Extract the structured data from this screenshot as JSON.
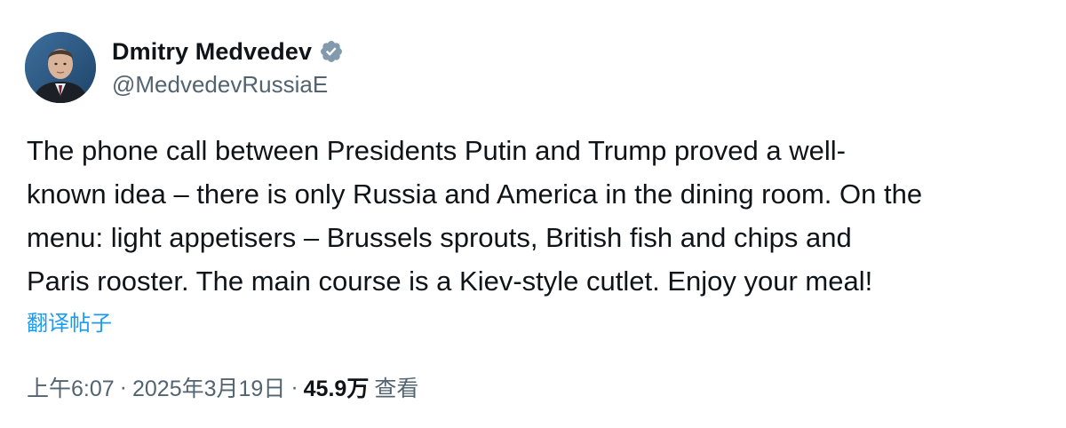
{
  "author": {
    "display_name": "Dmitry Medvedev",
    "handle": "@MedvedevRussiaE",
    "verified_color": "#829aab"
  },
  "post": {
    "text": "The phone call between Presidents Putin and Trump proved a well-\nknown idea – there is only Russia and America in the dining room. On the\nmenu: light appetisers – Brussels sprouts, British fish and chips and\nParis rooster. The main course is a Kiev-style cutlet. Enjoy your meal!",
    "translate_label": "翻译帖子"
  },
  "meta": {
    "time": "上午6:07",
    "separator": "·",
    "date": "2025年3月19日",
    "views_count": "45.9万",
    "views_label": "查看"
  },
  "colors": {
    "text_primary": "#0f1419",
    "text_secondary": "#536471",
    "link": "#1d9bf0"
  }
}
